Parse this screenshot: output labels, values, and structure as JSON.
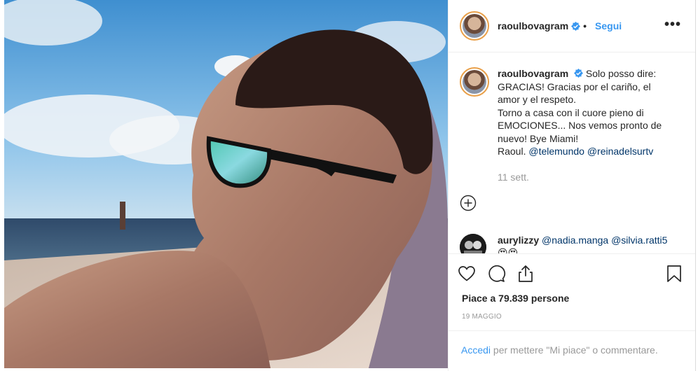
{
  "post": {
    "username": "raoulbovagram",
    "follow_separator": "•",
    "follow_label": "Segui",
    "more_label": "•••",
    "caption_lines": [
      "Solo posso dire:",
      "GRACIAS! Gracias por el cariño, el",
      "amor y el respeto.",
      "Torno a casa con il cuore pieno di",
      "EMOCIONES... Nos vemos pronto de",
      "nuevo! Bye Miami!",
      "Raoul. "
    ],
    "mention_1": "@telemundo",
    "mention_2": "@reinadelsurtv",
    "time_ago": "11 sett."
  },
  "comment": {
    "username": "aurylizzy",
    "mention_1": "@nadia.manga",
    "mention_2": "@silvia.ratti5",
    "emoji": "😍😍"
  },
  "actions": {
    "icons": [
      "heart-icon",
      "comment-icon",
      "share-icon",
      "bookmark-icon"
    ],
    "likes_text": "Piace a 79.839 persone",
    "date": "19 MAGGIO"
  },
  "login": {
    "link": "Accedi",
    "rest": " per mettere \"Mi piace\" o commentare."
  },
  "colors": {
    "accent": "#3897f0",
    "mention": "#003569",
    "muted": "#999999"
  }
}
